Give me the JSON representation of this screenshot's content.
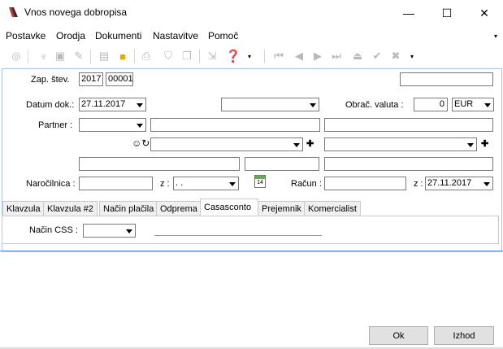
{
  "window": {
    "title": "Vnos novega dobropisa",
    "minimize": "—",
    "maximize": "☐",
    "close": "✕"
  },
  "menu": [
    "Postavke",
    "Orodja",
    "Dokumenti",
    "Nastavitve",
    "Pomoč"
  ],
  "form": {
    "zap_label": "Zap. štev.",
    "zap_year": "2017",
    "zap_number": "00001",
    "datum_label": "Datum dok.:",
    "datum_value": "27.11.2017",
    "obrac_label": "Obrač. valuta :",
    "obrac_value": "0",
    "currency": "EUR",
    "partner_label": "Partner :",
    "narocilnica_label": "Naročilnica :",
    "z_label1": "z :",
    "z_value1": ". .",
    "calendar_day": "14",
    "racun_label": "Račun :",
    "z_label2": "z :",
    "z_value2": "27.11.2017"
  },
  "tabs": [
    "Klavzula",
    "Klavzula #2",
    "Način plačila",
    "Odprema",
    "Casasconto",
    "Prejemnik",
    "Komercialist"
  ],
  "tab_panel": {
    "nacin_css_label": "Način CSS :"
  },
  "buttons": {
    "ok": "Ok",
    "cancel": "Izhod"
  }
}
